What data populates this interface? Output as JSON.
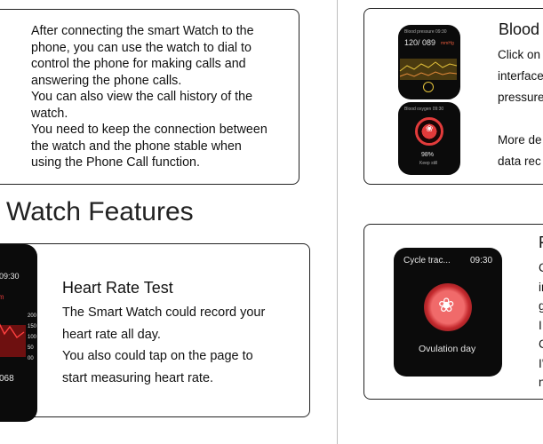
{
  "call_section": {
    "lines": [
      "After connecting the smart Watch to the",
      "phone, you can use the watch to dial to",
      "control the phone for making calls and",
      "answering the phone calls.",
      "You can also view the call history of the",
      "watch.",
      "You need to keep the connection between",
      "the watch and the phone stable when",
      "using the Phone Call function."
    ]
  },
  "features_heading": "Watch Features",
  "heart_rate": {
    "title": "Heart Rate Test",
    "lines": [
      "The Smart Watch could record your",
      "heart rate all day.",
      "You also could tap on the page to",
      "start measuring heart rate."
    ],
    "watch": {
      "time": "09:30",
      "unit": "bpm",
      "scale": [
        "200",
        "150",
        "100",
        "50",
        "00"
      ],
      "reading": "068",
      "accent_color": "#d62828"
    }
  },
  "blood": {
    "title": "Blood",
    "lines": [
      "Click on",
      "interface",
      "pressure",
      "",
      "More de",
      "data rec"
    ],
    "pressure_watch": {
      "label": "Blood pressure 09:30",
      "reading": "120/ 089",
      "unit": "mmHg"
    },
    "oxygen_watch": {
      "label": "Blood oxygen 09:30",
      "percent": "98%",
      "status": "Keep still"
    }
  },
  "cycle": {
    "title": "F",
    "lines": [
      "C",
      "in",
      "g",
      "I",
      "C",
      "I'",
      "n"
    ],
    "watch": {
      "label": "Cycle trac...",
      "time": "09:30",
      "status": "Ovulation day",
      "accent_color": "#e0464a"
    }
  }
}
